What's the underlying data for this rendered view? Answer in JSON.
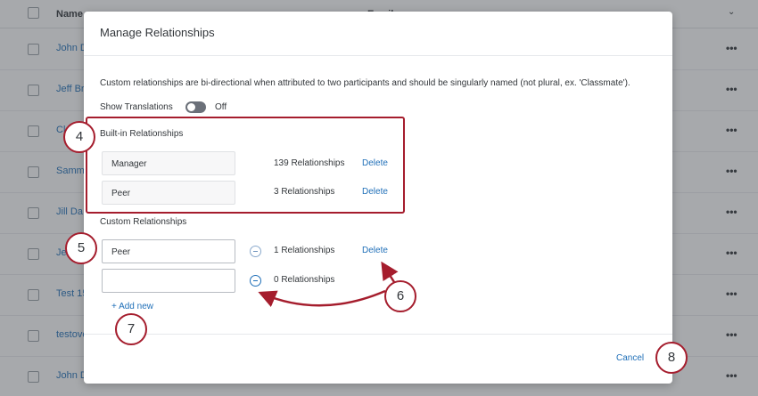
{
  "background": {
    "columns": [
      "Name",
      "Email"
    ],
    "rows": [
      "John D",
      "Jeff Br",
      "Cl",
      "Samm",
      "Jill Da",
      "Je",
      "Test 15",
      "testove",
      "John D"
    ]
  },
  "modal": {
    "title": "Manage Relationships",
    "description": "Custom relationships are bi-directional when attributed to two participants and should be singularly named (not plural, ex. 'Classmate').",
    "show_translations_label": "Show Translations",
    "toggle_state": "Off",
    "builtin_label": "Built-in Relationships",
    "builtin": [
      {
        "name": "Manager",
        "count": "139 Relationships",
        "delete": "Delete"
      },
      {
        "name": "Peer",
        "count": "3 Relationships",
        "delete": "Delete"
      }
    ],
    "custom_label": "Custom Relationships",
    "custom": [
      {
        "value": "Peer",
        "count": "1 Relationships",
        "delete": "Delete"
      },
      {
        "value": "",
        "count": "0 Relationships"
      }
    ],
    "add_new": "+ Add new",
    "cancel": "Cancel"
  },
  "callouts": [
    "4",
    "5",
    "6",
    "7",
    "8"
  ],
  "colors": {
    "accent": "#a51d2d",
    "link": "#1f6fb8"
  }
}
